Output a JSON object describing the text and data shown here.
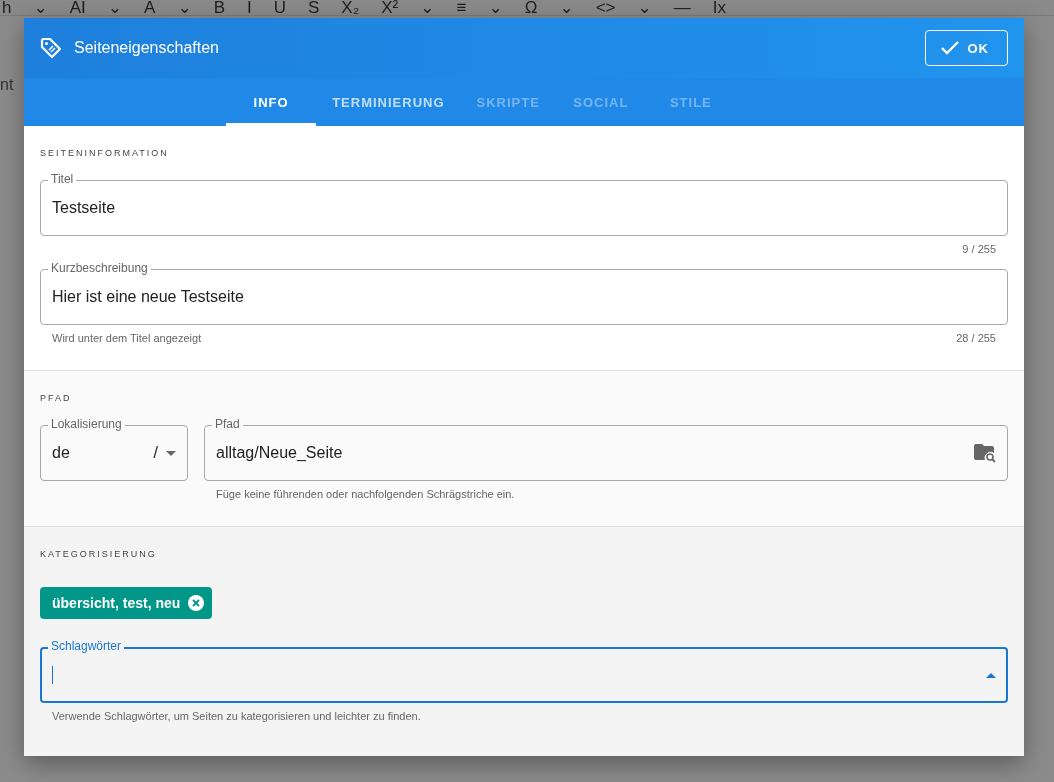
{
  "editor": {
    "toolbar": [
      "h",
      "⌄",
      "AI",
      "⌄",
      "A",
      "⌄",
      "B",
      "I",
      "U",
      "S",
      "X₂",
      "X²",
      "⌄",
      "≡",
      "⌄",
      "Ω",
      "⌄",
      "<>",
      "⌄",
      "—",
      "Ix"
    ],
    "text": "nt"
  },
  "dialog": {
    "title": "Seiteneigenschaften",
    "ok_button": "OK",
    "tabs": [
      {
        "label": "INFO",
        "selected": true,
        "disabled": false
      },
      {
        "label": "TERMINIERUNG",
        "selected": false,
        "disabled": false
      },
      {
        "label": "SKRIPTE",
        "selected": false,
        "disabled": true
      },
      {
        "label": "SOCIAL",
        "selected": false,
        "disabled": true
      },
      {
        "label": "STILE",
        "selected": false,
        "disabled": true
      }
    ],
    "sections": [
      {
        "heading": "SEITENINFORMATION",
        "fields": [
          {
            "kind": "text",
            "label": "Titel",
            "value": "Testseite",
            "counter": "9 / 255"
          },
          {
            "kind": "text",
            "label": "Kurzbeschreibung",
            "value": "Hier ist eine neue Testseite",
            "hint": "Wird unter dem Titel angezeigt",
            "counter": "28 / 255"
          }
        ]
      },
      {
        "heading": "PFAD",
        "fields": [
          {
            "kind": "locale",
            "label": "Lokalisierung",
            "value": "de",
            "suffix": "/"
          },
          {
            "kind": "path",
            "label": "Pfad",
            "value": "alltag/Neue_Seite",
            "hint": "Füge keine führenden oder nachfolgenden Schrägstriche ein."
          }
        ]
      },
      {
        "heading": "KATEGORISIERUNG",
        "chips": [
          "übersicht, test, neu"
        ],
        "fields": [
          {
            "kind": "combo",
            "label": "Schlagwörter",
            "focused": true,
            "hint": "Verwende Schlagwörter, um Seiten zu kategorisieren und leichter zu finden."
          }
        ]
      }
    ]
  }
}
